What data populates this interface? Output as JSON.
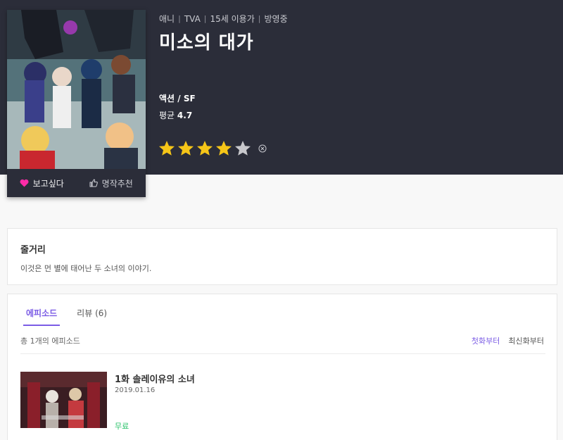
{
  "meta": {
    "category": "애니",
    "format": "TVA",
    "rating": "15세 이용가",
    "status": "방영중"
  },
  "title": "미소의 대가",
  "genre": "액션 / SF",
  "average": {
    "label": "평균",
    "value": "4.7"
  },
  "user_rating": {
    "stars": 4,
    "max": 5
  },
  "colors": {
    "accent": "#7b5ce5",
    "star_on": "#f5c518",
    "star_off": "#c8c8cc",
    "heart": "#ff2ba8",
    "free": "#29c26a",
    "hero_bg": "#2b2d39"
  },
  "actions": {
    "want": {
      "label": "보고싶다",
      "icon": "heart-icon"
    },
    "recommend": {
      "label": "명작추천",
      "icon": "thumbs-up-icon"
    }
  },
  "synopsis": {
    "heading": "줄거리",
    "text": "이것은 먼 별에 태어난 두 소녀의 이야기."
  },
  "tabs": [
    {
      "label": "에피소드",
      "active": true
    },
    {
      "label": "리뷰 (6)",
      "active": false
    }
  ],
  "episode_count": "총 1개의 에피소드",
  "sort": {
    "first": "첫화부터",
    "latest": "최신화부터"
  },
  "episodes": [
    {
      "title": "1화 솔레이유의 소녀",
      "date": "2019.01.16",
      "price": "무료"
    }
  ]
}
